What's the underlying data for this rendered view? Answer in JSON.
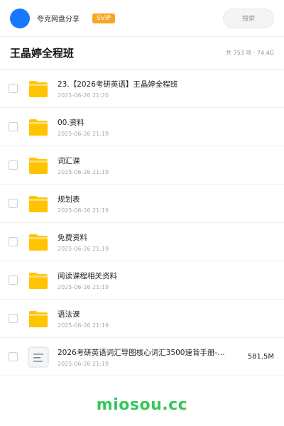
{
  "header": {
    "share_name": "夸克网盘分享",
    "vip_label": "SVIP",
    "search_placeholder": "搜索"
  },
  "title_bar": {
    "title": "王晶婷全程班",
    "summary": "共 753 项 · 74.4G"
  },
  "files": [
    {
      "type": "folder",
      "name": "23.【2026考研英语】王晶婷全程班",
      "date": "2025-06-26 21:20",
      "size": ""
    },
    {
      "type": "folder",
      "name": "00.资料",
      "date": "2025-06-26 21:19",
      "size": ""
    },
    {
      "type": "folder",
      "name": "词汇课",
      "date": "2025-06-26 21:19",
      "size": ""
    },
    {
      "type": "folder",
      "name": "规划表",
      "date": "2025-06-26 21:19",
      "size": ""
    },
    {
      "type": "folder",
      "name": "免费资料",
      "date": "2025-06-26 21:19",
      "size": ""
    },
    {
      "type": "folder",
      "name": "阅读课程相关资料",
      "date": "2025-06-26 21:19",
      "size": ""
    },
    {
      "type": "folder",
      "name": "语法课",
      "date": "2025-06-26 21:19",
      "size": ""
    },
    {
      "type": "document",
      "name": "2026考研英语词汇导图核心词汇3500速背手册-…",
      "date": "2025-06-26 21:19",
      "size": "581.5M"
    }
  ],
  "footer": {
    "watermark": "miosou.cc"
  },
  "colors": {
    "avatar": "#1677ff",
    "vip_badge": "#f5a623",
    "folder": "#ffc400",
    "watermark": "#34c759"
  },
  "icons": {
    "folder": "folder-icon",
    "document": "document-icon"
  }
}
